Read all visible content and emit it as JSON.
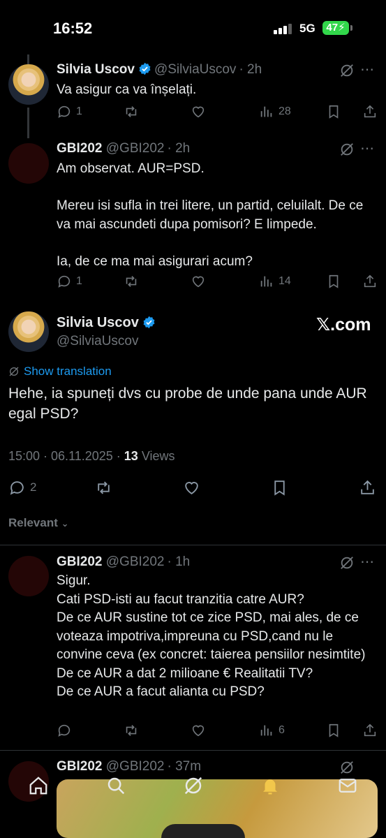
{
  "status_bar": {
    "time": "16:52",
    "network": "5G",
    "battery": "47"
  },
  "tweets": [
    {
      "name": "Silvia Uscov",
      "handle": "@SilviaUscov",
      "time": "· 2h",
      "text": "Va asigur ca va înșelați.",
      "replies": "1",
      "views": "28"
    },
    {
      "name": "GBI202",
      "handle": "@GBI202",
      "time": "· 2h",
      "text": "Am observat. AUR=PSD.\n\nMereu isi sufla in trei litere, un partid, celuilalt. De ce va mai ascundeti dupa pomisori? E limpede.\n\nIa, de ce ma mai asigurari acum?",
      "replies": "1",
      "views": "14"
    }
  ],
  "main_tweet": {
    "name": "Silvia Uscov",
    "handle": "@SilviaUscov",
    "watermark": "𝕏.com",
    "show_translation": "Show translation",
    "text": "Hehe, ia spuneți dvs cu probe de unde pana unde AUR egal PSD?",
    "timestamp": "15:00 · 06.11.2025 · ",
    "views_count": "13",
    "views_label": " Views",
    "replies": "2"
  },
  "sort_label": "Relevant",
  "replies": [
    {
      "name": "GBI202",
      "handle": "@GBI202",
      "time": "· 1h",
      "text": "Sigur.\nCati PSD-isti au facut tranzitia catre AUR?\nDe ce AUR sustine tot ce zice PSD, mai ales, de ce voteaza impotriva,impreuna cu PSD,cand nu le convine ceva (ex concret: taierea pensiilor nesimtite)\nDe ce AUR a dat 2 milioane € Realitatii TV?\nDe ce AUR a facut alianta cu PSD?",
      "views": "6"
    },
    {
      "name": "GBI202",
      "handle": "@GBI202",
      "time": "· 37m"
    }
  ],
  "colors": {
    "accent": "#1d9bf0",
    "secondary_text": "#71767b",
    "battery": "#32d74b"
  }
}
